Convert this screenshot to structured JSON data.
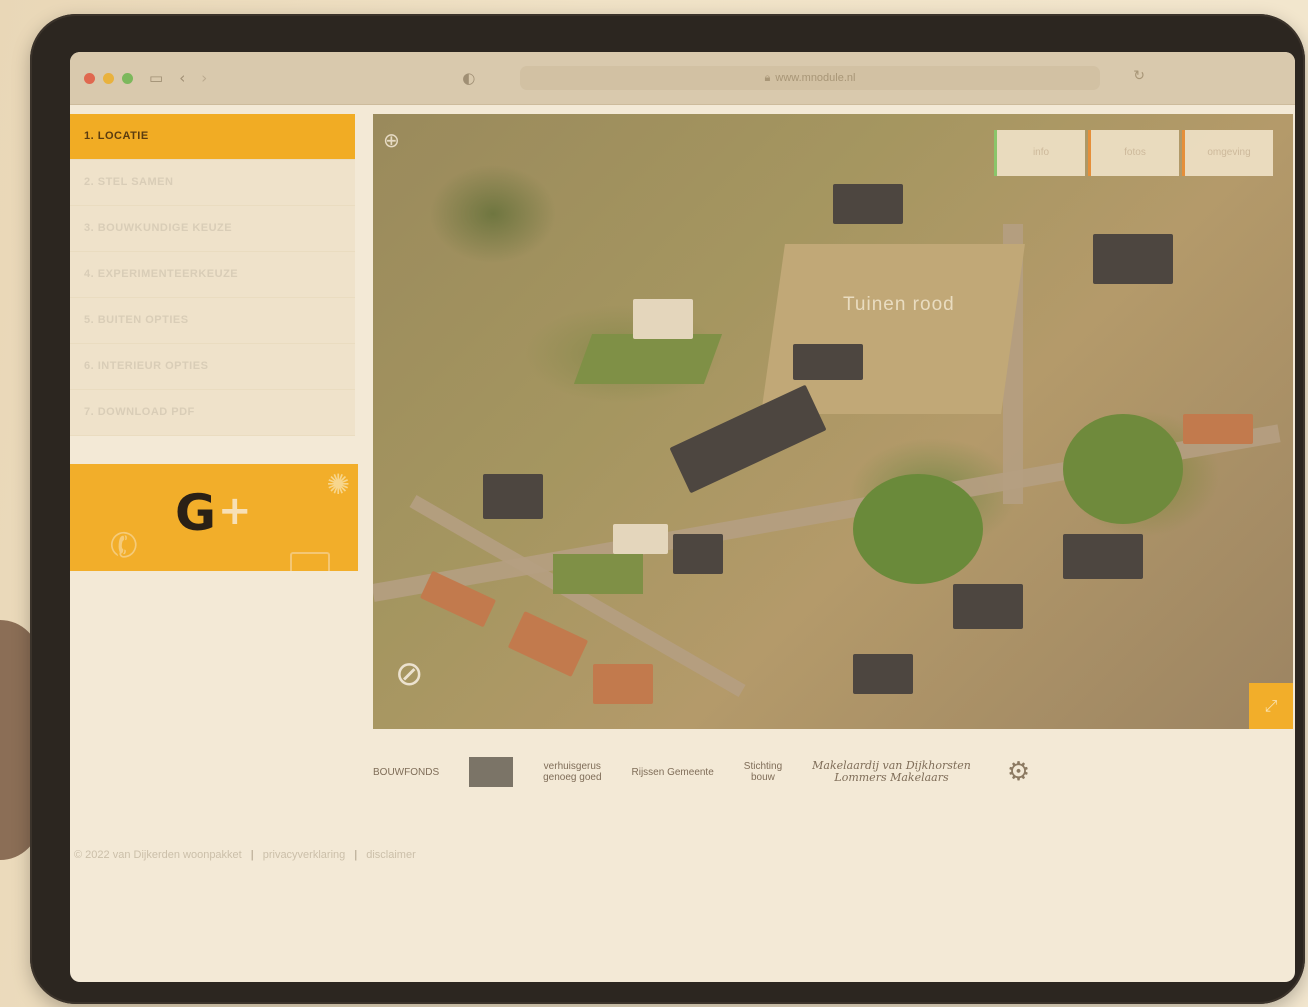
{
  "browser": {
    "url": "www.mnodule.nl"
  },
  "sidebar": {
    "steps": [
      {
        "label": "1. LOCATIE",
        "active": true
      },
      {
        "label": "2. STEL SAMEN"
      },
      {
        "label": "3. BOUWKUNDIGE KEUZE"
      },
      {
        "label": "4. EXPERIMENTEERKEUZE"
      },
      {
        "label": "5. BUITEN OPTIES"
      },
      {
        "label": "6. INTERIEUR OPTIES"
      },
      {
        "label": "7. DOWNLOAD PDF"
      }
    ],
    "promo_logo": "G",
    "promo_plus": "+"
  },
  "map": {
    "field_label": "Tuinen rood",
    "tabs": [
      {
        "label": "info"
      },
      {
        "label": "fotos"
      },
      {
        "label": "omgeving"
      }
    ]
  },
  "partners": {
    "items": [
      {
        "label": "BOUWFONDS"
      },
      {
        "label": "verhuisgerus\ngenoeg goed"
      },
      {
        "label": "Rijssen Gemeente"
      },
      {
        "label": "Stichting\nbouw"
      },
      {
        "label": "Makelaardij van Dijkhorsten\nLommers Makelaars"
      }
    ]
  },
  "footer": {
    "copyright": "© 2022",
    "links": [
      "van Dijkerden woonpakket",
      "privacyverklaring",
      "disclaimer"
    ]
  },
  "colors": {
    "accent": "#f1ac24",
    "frame": "#2c2620"
  }
}
